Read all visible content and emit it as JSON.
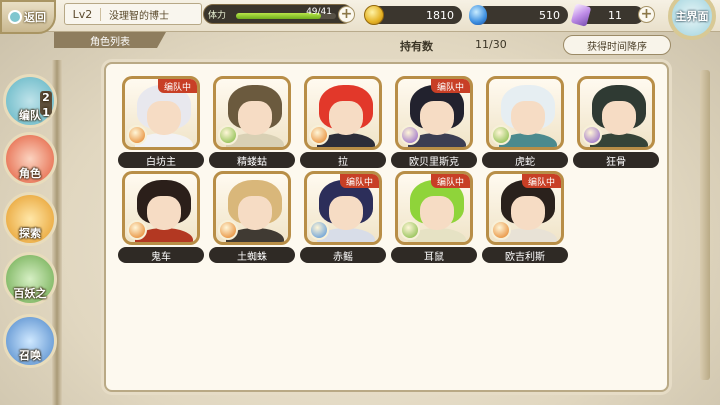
{
  "header": {
    "back_label": "返回",
    "level": "Lv2",
    "player_name": "没理智的博士",
    "stamina_label": "体力",
    "stamina_value": "49/41",
    "stamina_fill": 0.85,
    "gold": "1810",
    "gems": "510",
    "crystals": "11",
    "home_label": "主界面"
  },
  "subheader": {
    "tab_label": "角色列表",
    "hold_label": "持有数",
    "hold_count": "11/30",
    "sort_label": "获得时间降序"
  },
  "sidebar": {
    "items": [
      {
        "label": "编队",
        "badge_top": "2",
        "badge_bottom": "1"
      },
      {
        "label": "角色"
      },
      {
        "label": "探索"
      },
      {
        "label": "百妖之"
      },
      {
        "label": "召唤"
      }
    ]
  },
  "characters": [
    {
      "name": "白坊主",
      "team": "编队中",
      "hair": "#e8e8ee",
      "body": "#f2f2f4",
      "elem": "#e37b1c"
    },
    {
      "name": "精蝼蛄",
      "team": "",
      "hair": "#6b5a3e",
      "body": "#d9d0b4",
      "elem": "#7bb63a"
    },
    {
      "name": "拉",
      "team": "",
      "hair": "#e2382a",
      "body": "#2c2d39",
      "elem": "#e37b1c"
    },
    {
      "name": "欧贝里斯克",
      "team": "编队中",
      "hair": "#22222e",
      "body": "#3b3d52",
      "elem": "#8b5cc7"
    },
    {
      "name": "虎蛇",
      "team": "",
      "hair": "#e6eef2",
      "body": "#4c8a8e",
      "elem": "#7bb63a"
    },
    {
      "name": "狂骨",
      "team": "",
      "hair": "#2f3a33",
      "body": "#364438",
      "elem": "#8b5cc7"
    },
    {
      "name": "鬼车",
      "team": "",
      "hair": "#2b1f1a",
      "body": "#b33822",
      "elem": "#e37b1c"
    },
    {
      "name": "土蜘蛛",
      "team": "",
      "hair": "#d9b77a",
      "body": "#403a33",
      "elem": "#e37b1c"
    },
    {
      "name": "赤鳐",
      "team": "编队中",
      "hair": "#2c2e5a",
      "body": "#d8dde8",
      "elem": "#4b8fd8"
    },
    {
      "name": "耳鼠",
      "team": "编队中",
      "hair": "#8fd43a",
      "body": "#e6e2c4",
      "elem": "#7bb63a"
    },
    {
      "name": "欧吉利斯",
      "team": "编队中",
      "hair": "#2a211c",
      "body": "#e8e2d6",
      "elem": "#e37b1c"
    }
  ]
}
